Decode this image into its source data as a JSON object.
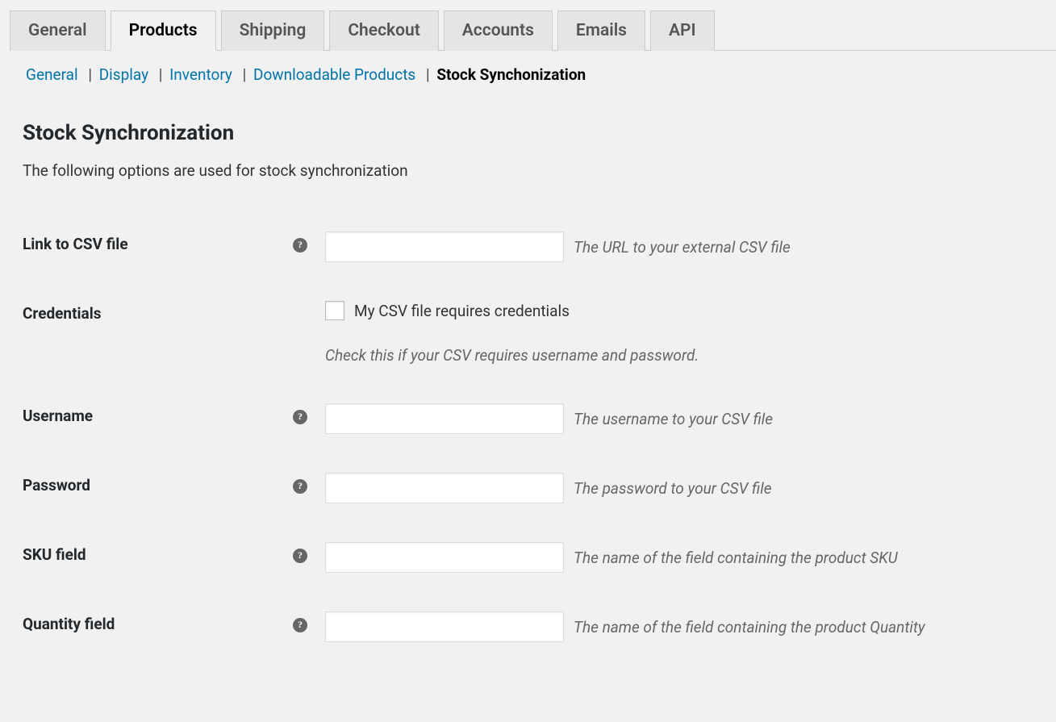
{
  "tabs": {
    "general": "General",
    "products": "Products",
    "shipping": "Shipping",
    "checkout": "Checkout",
    "accounts": "Accounts",
    "emails": "Emails",
    "api": "API"
  },
  "subnav": {
    "general": "General",
    "display": "Display",
    "inventory": "Inventory",
    "downloadable": "Downloadable Products",
    "stock_sync": "Stock Synchonization"
  },
  "page": {
    "title": "Stock Synchronization",
    "description": "The following options are used for stock synchronization"
  },
  "fields": {
    "csv_link": {
      "label": "Link to CSV file",
      "value": "",
      "hint": "The URL to your external CSV file"
    },
    "credentials": {
      "label": "Credentials",
      "checkbox_label": "My CSV file requires credentials",
      "description": "Check this if your CSV requires username and password."
    },
    "username": {
      "label": "Username",
      "value": "",
      "hint": "The username to your CSV file"
    },
    "password": {
      "label": "Password",
      "value": "",
      "hint": "The password to your CSV file"
    },
    "sku_field": {
      "label": "SKU field",
      "value": "",
      "hint": "The name of the field containing the product SKU"
    },
    "quantity_field": {
      "label": "Quantity field",
      "value": "",
      "hint": "The name of the field containing the product Quantity"
    }
  }
}
